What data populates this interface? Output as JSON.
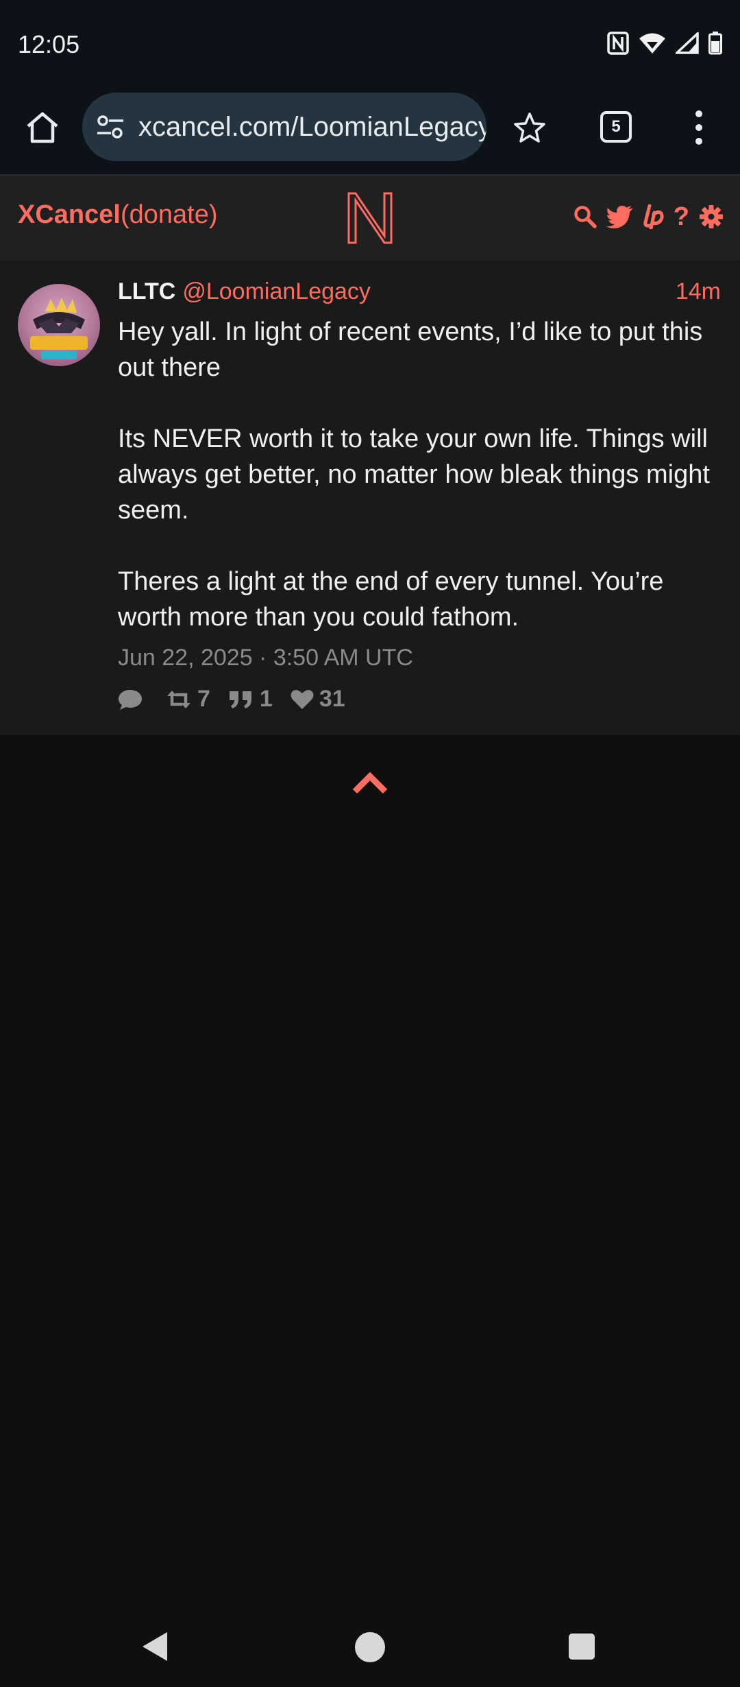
{
  "status_bar": {
    "time": "12:05",
    "icons": [
      "nfc-icon",
      "wifi-icon",
      "signal-icon",
      "battery-icon"
    ]
  },
  "browser": {
    "url": "xcancel.com/LoomianLegacy",
    "tab_count": "5"
  },
  "site": {
    "brand_name": "XCancel",
    "brand_donate": "(donate)",
    "header_icons": [
      "search-icon",
      "twitter-icon",
      "liberapay-icon",
      "help-icon",
      "settings-icon"
    ]
  },
  "tweet": {
    "fullname": "LLTC",
    "username": "@LoomianLegacy",
    "time_ago": "14m",
    "paragraphs": [
      "Hey yall. In light of recent events, I’d like to put this out there",
      "Its NEVER worth it to take your own life. Things will always get better, no matter how bleak things might seem.",
      "Theres a light at the end of every tunnel. You’re worth more than you could fathom."
    ],
    "date": "Jun 22, 2025 · 3:50 AM UTC",
    "stats": {
      "replies": "",
      "retweets": "7",
      "quotes": "1",
      "likes": "31"
    }
  },
  "colors": {
    "accent": "#ff6c60",
    "background": "#0f0f0f",
    "card": "#1a1a1a",
    "header": "#202020",
    "chrome": "#0c1217",
    "urlbar": "#243441"
  }
}
